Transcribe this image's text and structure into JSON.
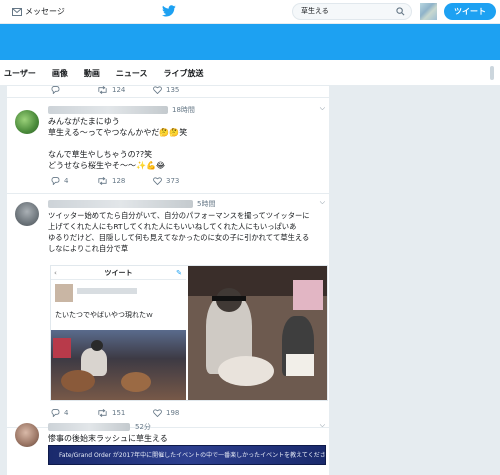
{
  "header": {
    "messages_label": "メッセージ",
    "search_value": "草生える",
    "tweet_button": "ツイート"
  },
  "nav": {
    "tabs": [
      "ユーザー",
      "画像",
      "動画",
      "ニュース",
      "ライブ放送"
    ]
  },
  "feed": {
    "top_actions": {
      "retweets": "124",
      "likes": "135"
    },
    "tweets": [
      {
        "time": "18時間",
        "lines": [
          "みんながたまにゆう",
          "草生える〜ってやつなんかやだ🤔🤔笑",
          "",
          "なんで草生やしちゃうの??笑",
          "どうせなら桜生やそ〜〜✨💪😂"
        ],
        "replies": "4",
        "retweets": "128",
        "likes": "373"
      },
      {
        "time": "5時間",
        "lines": [
          "ツイッター始めてたら自分がいて、自分のパフォーマンスを撮ってツイッターに",
          "上げてくれた人にもRTしてくれた人にもいいねしてくれた人にもいっぱいあ",
          "ゆるりだけど、目隠しして何も見えてなかったのに女の子に引かれてて草生える",
          "しなによりこれ自分で草"
        ],
        "card": {
          "header": "ツイート",
          "caption": "たいたつでやばいやつ現れたｗ"
        },
        "replies": "4",
        "retweets": "151",
        "likes": "198"
      },
      {
        "time": "52分",
        "lines": [
          "惨事の後始末ラッシュに草生える"
        ],
        "banner": "Fate/Grand Order が2017年中に開催したイベントの中で一番楽しかったイベントを教えてください"
      }
    ]
  },
  "colors": {
    "brand": "#1da1f2",
    "background": "#e6ecf0"
  }
}
